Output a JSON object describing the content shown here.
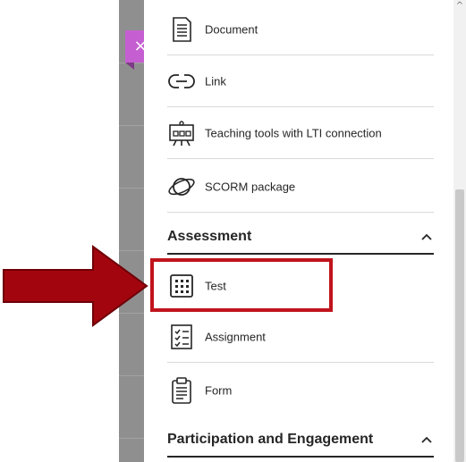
{
  "close_button": {
    "label": "×"
  },
  "items_top": [
    {
      "id": "document",
      "label": "Document",
      "icon": "document-icon"
    },
    {
      "id": "link",
      "label": "Link",
      "icon": "link-icon"
    },
    {
      "id": "lti",
      "label": "Teaching tools with LTI connection",
      "icon": "lti-tools-icon"
    },
    {
      "id": "scorm",
      "label": "SCORM package",
      "icon": "scorm-icon"
    }
  ],
  "sections": [
    {
      "title": "Assessment",
      "chevron": "chevron-up-icon",
      "items": [
        {
          "id": "test",
          "label": "Test",
          "icon": "test-icon",
          "highlighted": true
        },
        {
          "id": "assignment",
          "label": "Assignment",
          "icon": "assignment-icon"
        },
        {
          "id": "form",
          "label": "Form",
          "icon": "form-icon"
        }
      ]
    },
    {
      "title": "Participation and Engagement",
      "chevron": "chevron-up-icon",
      "items": []
    }
  ],
  "annotation": {
    "arrow_color": "#c0141c",
    "highlight_color": "#c0141c"
  },
  "colors": {
    "close_tab": "#c55fd1",
    "gray_strip": "#8f8f8f"
  }
}
